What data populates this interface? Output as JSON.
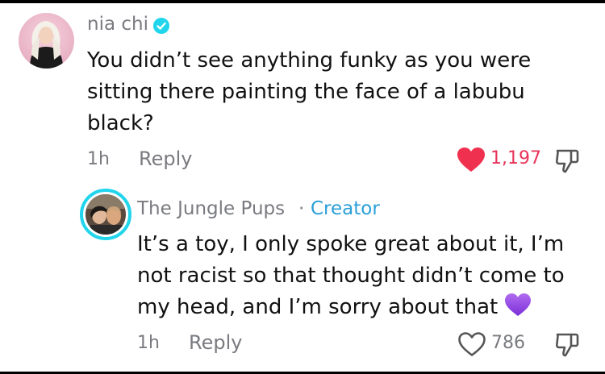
{
  "comment": {
    "username": "nia chi",
    "verified_icon": "verified-badge-icon",
    "text": "You didn’t see anything funky as you were sitting there painting the face of a labubu black?",
    "lines": [
      "You didn’t see anything funky as you were",
      "sitting there painting the face of a labubu",
      "black?"
    ],
    "time": "1h",
    "reply_label": "Reply",
    "like_count": "1,197",
    "liked": true
  },
  "reply": {
    "username": "The Jungle Pups",
    "separator": "·",
    "creator_tag": "Creator",
    "lines": [
      "It’s a toy, I only spoke great about it, I’m",
      "not racist so that thought didn’t come to",
      "my head, and I’m sorry about that"
    ],
    "emoji": "purple-heart-emoji",
    "time": "1h",
    "reply_label": "Reply",
    "like_count": "786",
    "liked": false
  },
  "colors": {
    "like_active": "#e8345a",
    "creator_accent": "#2b9fd8",
    "avatar_ring": "#20d5ec",
    "verified": "#20d5ec",
    "muted_text": "#7a7b81"
  }
}
